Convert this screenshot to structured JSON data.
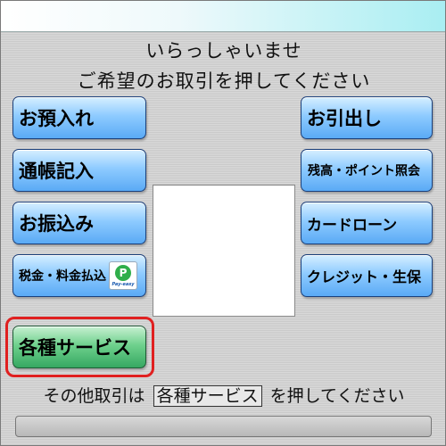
{
  "header": {
    "greeting_line1": "いらっしゃいませ",
    "greeting_line2": "ご希望のお取引を押してください"
  },
  "left_buttons": {
    "deposit": "お預入れ",
    "passbook": "通帳記入",
    "transfer": "お振込み",
    "tax_payment": "税金・料金払込"
  },
  "right_buttons": {
    "withdrawal": "お引出し",
    "balance": "残高・ポイント照会",
    "card_loan": "カードローン",
    "credit": "クレジット・生保"
  },
  "services_button": "各種サービス",
  "payeasy": {
    "letter": "P",
    "text": "Pay-easy"
  },
  "footer": {
    "prefix": "その他取引は",
    "boxed": "各種サービス",
    "suffix": "を押してください"
  },
  "colors": {
    "button_blue": "#8ecbff",
    "button_green": "#6fd18d",
    "highlight_red": "#e02020"
  }
}
